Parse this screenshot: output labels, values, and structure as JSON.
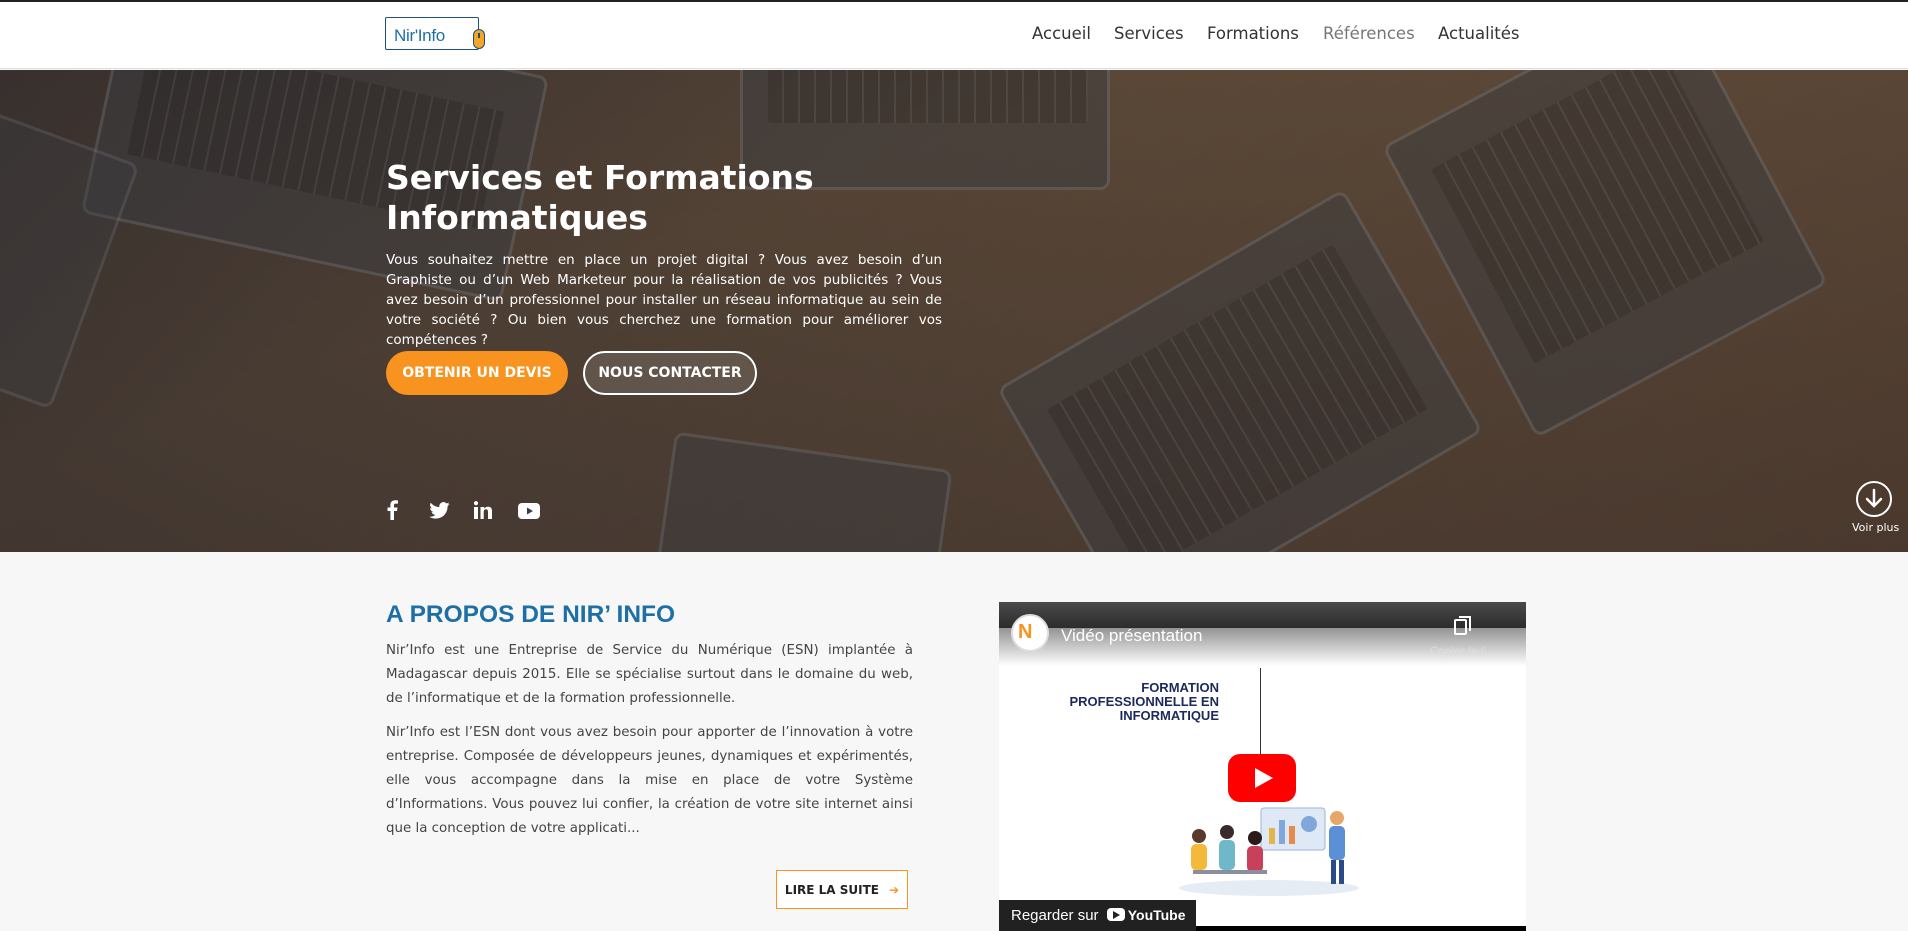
{
  "header": {
    "logo_text": "Nir'Info",
    "nav": [
      {
        "label": "Accueil"
      },
      {
        "label": "Services"
      },
      {
        "label": "Formations"
      },
      {
        "label": "Références"
      },
      {
        "label": "Actualités"
      }
    ]
  },
  "hero": {
    "title": "Services et Formations Informatiques",
    "description": "Vous souhaitez mettre en place un projet digital ? Vous avez besoin d’un Graphiste ou d’un Web Marketeur pour la réalisation de vos publicités ? Vous avez besoin d’un professionnel pour installer un réseau informatique au sein de votre société ? Ou bien vous cherchez une formation pour améliorer vos compétences ?",
    "primary_button": "OBTENIR UN DEVIS",
    "secondary_button": "NOUS CONTACTER",
    "social_icons": [
      "facebook-icon",
      "twitter-icon",
      "linkedin-icon",
      "youtube-icon"
    ],
    "scroll_label": "Voir plus"
  },
  "about": {
    "heading": "A PROPOS DE NIR’ INFO",
    "paragraph_1": "Nir’Info est une Entreprise de Service du Numérique (ESN) implantée à Madagascar depuis 2015. Elle se spécialise surtout dans le domaine du web, de l’informatique et de la formation professionnelle.",
    "paragraph_2": "Nir’Info est l’ESN dont vous avez besoin pour apporter de l’innovation à votre entreprise. Composée de développeurs jeunes, dynamiques et expérimentés, elle vous accompagne dans la mise en place de votre Système d’Informations. Vous pouvez lui confier, la création de votre site internet ainsi que la conception de votre applicati...",
    "read_more_button": "LIRE LA SUITE"
  },
  "video": {
    "title": "Vidéo présentation",
    "copy_label": "Copier le li...",
    "thumbnail_heading": "FORMATION PROFESSIONNELLE EN INFORMATIQUE",
    "watch_on": "Regarder sur",
    "platform": "YouTube"
  },
  "colors": {
    "accent_orange": "#f7931e",
    "heading_blue": "#1d6fa5"
  }
}
